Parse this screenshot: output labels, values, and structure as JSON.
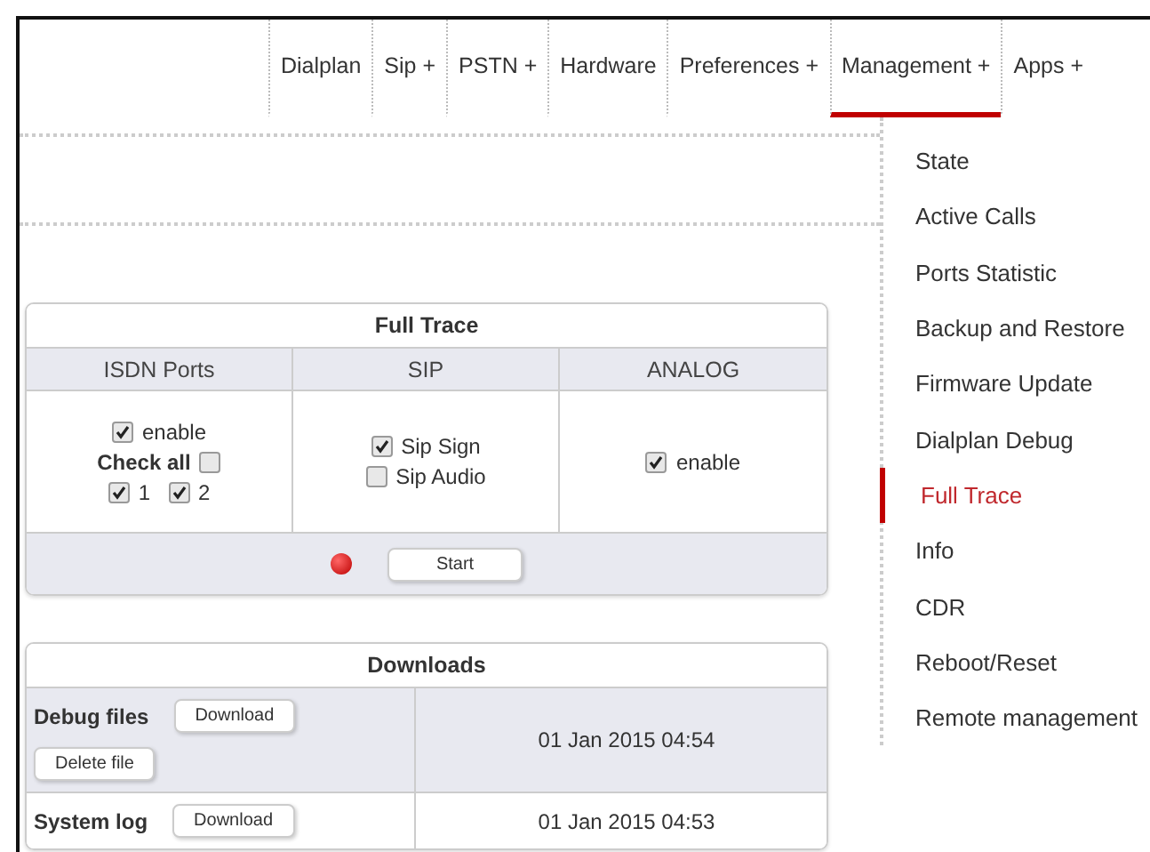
{
  "nav": {
    "items": [
      {
        "label": "Dialplan",
        "selected": false
      },
      {
        "label": "Sip +",
        "selected": false
      },
      {
        "label": "PSTN +",
        "selected": false
      },
      {
        "label": "Hardware",
        "selected": false
      },
      {
        "label": "Preferences +",
        "selected": false
      },
      {
        "label": "Management +",
        "selected": true
      },
      {
        "label": "Apps +",
        "selected": false
      }
    ]
  },
  "dropdown": {
    "items": [
      {
        "label": "State",
        "selected": false
      },
      {
        "label": "Active Calls",
        "selected": false
      },
      {
        "label": "Ports Statistic",
        "selected": false
      },
      {
        "label": "Backup and Restore",
        "selected": false
      },
      {
        "label": "Firmware Update",
        "selected": false
      },
      {
        "label": "Dialplan Debug",
        "selected": false
      },
      {
        "label": "Full Trace",
        "selected": true
      },
      {
        "label": "Info",
        "selected": false
      },
      {
        "label": "CDR",
        "selected": false
      },
      {
        "label": "Reboot/Reset",
        "selected": false
      },
      {
        "label": "Remote management",
        "selected": false
      }
    ]
  },
  "full_trace": {
    "title": "Full Trace",
    "columns": [
      "ISDN Ports",
      "SIP",
      "ANALOG"
    ],
    "isdn": {
      "enable": {
        "label": "enable",
        "checked": true
      },
      "check_all": {
        "label": "Check all",
        "checked": false
      },
      "ports": [
        {
          "label": "1",
          "checked": true
        },
        {
          "label": "2",
          "checked": true
        }
      ]
    },
    "sip": [
      {
        "label": "Sip Sign",
        "checked": true
      },
      {
        "label": "Sip Audio",
        "checked": false
      }
    ],
    "analog": {
      "label": "enable",
      "checked": true
    },
    "running": false,
    "start": "Start"
  },
  "downloads": {
    "title": "Downloads",
    "rows": [
      {
        "label": "Debug files",
        "buttons": [
          "Download",
          "Delete file"
        ],
        "date": "01 Jan 2015 04:54"
      },
      {
        "label": "System log",
        "buttons": [
          "Download"
        ],
        "date": "01 Jan 2015 04:53"
      }
    ]
  }
}
